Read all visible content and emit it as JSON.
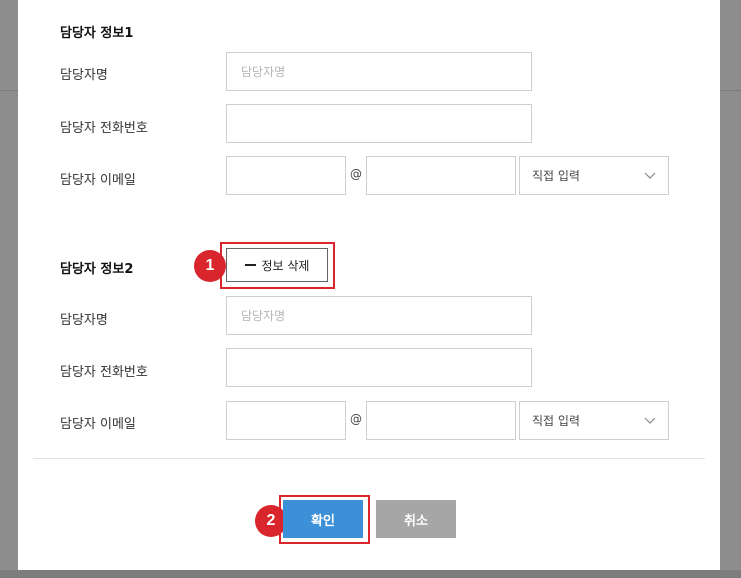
{
  "section1": {
    "title": "담당자 정보1",
    "name_label": "담당자명",
    "name_placeholder": "담당자명",
    "phone_label": "담당자 전화번호",
    "email_label": "담당자 이메일",
    "at_sign": "@",
    "domain_select": "직접 입력"
  },
  "section2": {
    "title": "담당자 정보2",
    "delete_button": "정보 삭제",
    "name_label": "담당자명",
    "name_placeholder": "담당자명",
    "phone_label": "담당자 전화번호",
    "email_label": "담당자 이메일",
    "at_sign": "@",
    "domain_select": "직접 입력"
  },
  "footer": {
    "confirm_label": "확인",
    "cancel_label": "취소"
  },
  "annotations": {
    "badge1": "1",
    "badge2": "2",
    "highlight_color": "#d9262d"
  },
  "colors": {
    "confirm_bg": "#3b90d8",
    "cancel_bg": "#a6a6a6"
  }
}
